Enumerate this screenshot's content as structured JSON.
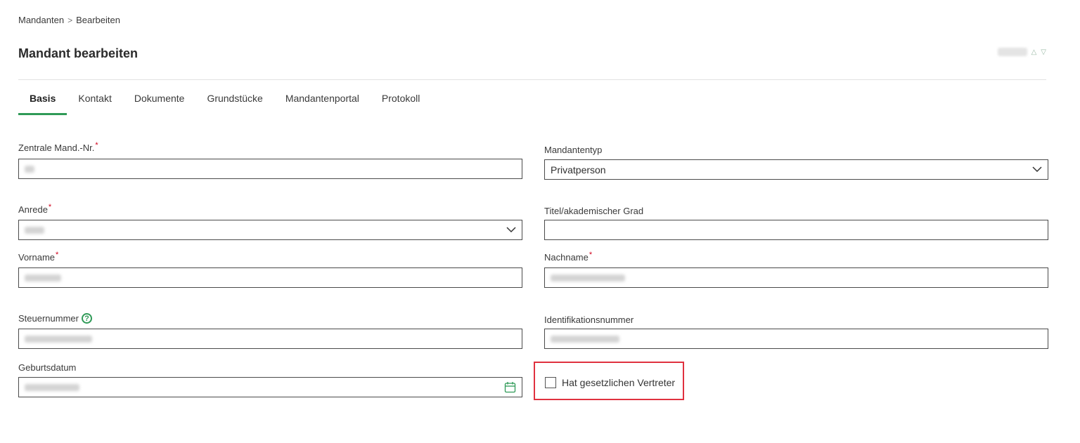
{
  "breadcrumb": {
    "parent": "Mandanten",
    "separator": ">",
    "current": "Bearbeiten"
  },
  "page": {
    "title": "Mandant bearbeiten"
  },
  "tabs": [
    {
      "label": "Basis",
      "active": true
    },
    {
      "label": "Kontakt",
      "active": false
    },
    {
      "label": "Dokumente",
      "active": false
    },
    {
      "label": "Grundstücke",
      "active": false
    },
    {
      "label": "Mandantenportal",
      "active": false
    },
    {
      "label": "Protokoll",
      "active": false
    }
  ],
  "form": {
    "zentrale_nr": {
      "label": "Zentrale Mand.-Nr.",
      "required_mark": "*"
    },
    "mandantentyp": {
      "label": "Mandantentyp",
      "value": "Privatperson"
    },
    "anrede": {
      "label": "Anrede",
      "required_mark": "*"
    },
    "titel": {
      "label": "Titel/akademischer Grad",
      "value": ""
    },
    "vorname": {
      "label": "Vorname",
      "required_mark": "*"
    },
    "nachname": {
      "label": "Nachname",
      "required_mark": "*"
    },
    "steuernummer": {
      "label": "Steuernummer",
      "help_glyph": "?"
    },
    "identifikationsnummer": {
      "label": "Identifikationsnummer"
    },
    "geburtsdatum": {
      "label": "Geburtsdatum"
    },
    "gesetzlicher_vertreter": {
      "label": "Hat gesetzlichen Vertreter",
      "checked": false
    }
  },
  "colors": {
    "accent": "#2f9a57",
    "required": "#d0021b",
    "highlight": "#e0313f",
    "border": "#4a4a4a"
  },
  "icons": {
    "dropdown": "chevron-down-icon",
    "calendar": "calendar-icon",
    "help": "help-circle-icon",
    "tab_arrows": "chevron-up-down-icon"
  }
}
